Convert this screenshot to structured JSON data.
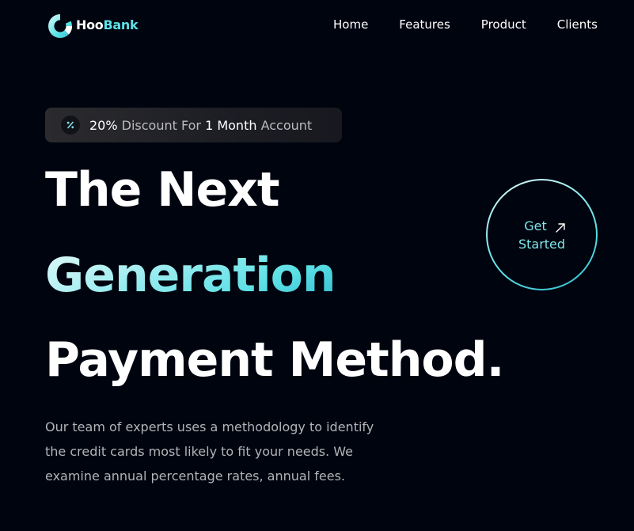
{
  "brand": {
    "name_part1": "Hoo",
    "name_part2": "Bank",
    "accent": "#5ce1e6",
    "background": "#00040f"
  },
  "nav": {
    "items": [
      {
        "label": "Home"
      },
      {
        "label": "Features"
      },
      {
        "label": "Product"
      },
      {
        "label": "Clients"
      }
    ]
  },
  "promo": {
    "icon": "discount-icon",
    "percent": "20%",
    "text1": " Discount For ",
    "duration": "1 Month",
    "text2": " Account"
  },
  "hero": {
    "line1": "The Next",
    "line2": "Generation",
    "line3": "Payment Method.",
    "description": "Our team of experts uses a methodology to identify the credit cards most likely to fit your needs. We examine annual percentage rates, annual fees."
  },
  "cta": {
    "line1": "Get",
    "line2": "Started",
    "icon": "arrow-up-right-icon"
  }
}
